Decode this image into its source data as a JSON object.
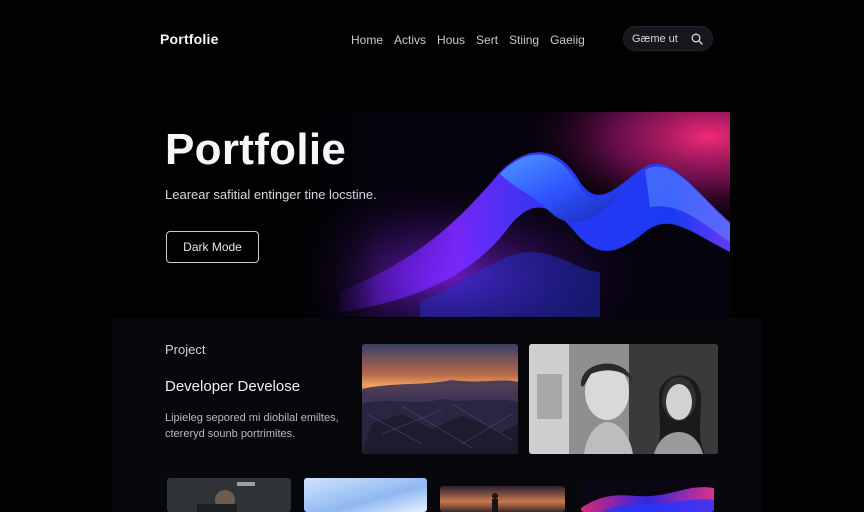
{
  "header": {
    "logo": "Portfolie",
    "nav": [
      "Home",
      "Activs",
      "Hous",
      "Sert",
      "Stiing",
      "Gaeiig"
    ],
    "search": {
      "placeholder": "Gæme ut",
      "icon": "search-icon"
    }
  },
  "hero": {
    "title": "Portfolie",
    "subtitle": "Learear safitial entinger tine locstine.",
    "button_label": "Dark Mode"
  },
  "project": {
    "label": "Project",
    "heading": "Developer Develose",
    "description": "Lipieleg sepored mi diobilal emiltes, ctereryd sounb portrimites."
  },
  "colors": {
    "background": "#020203",
    "accent_blue": "#2a3bff",
    "accent_magenta": "#ff2d8a"
  }
}
